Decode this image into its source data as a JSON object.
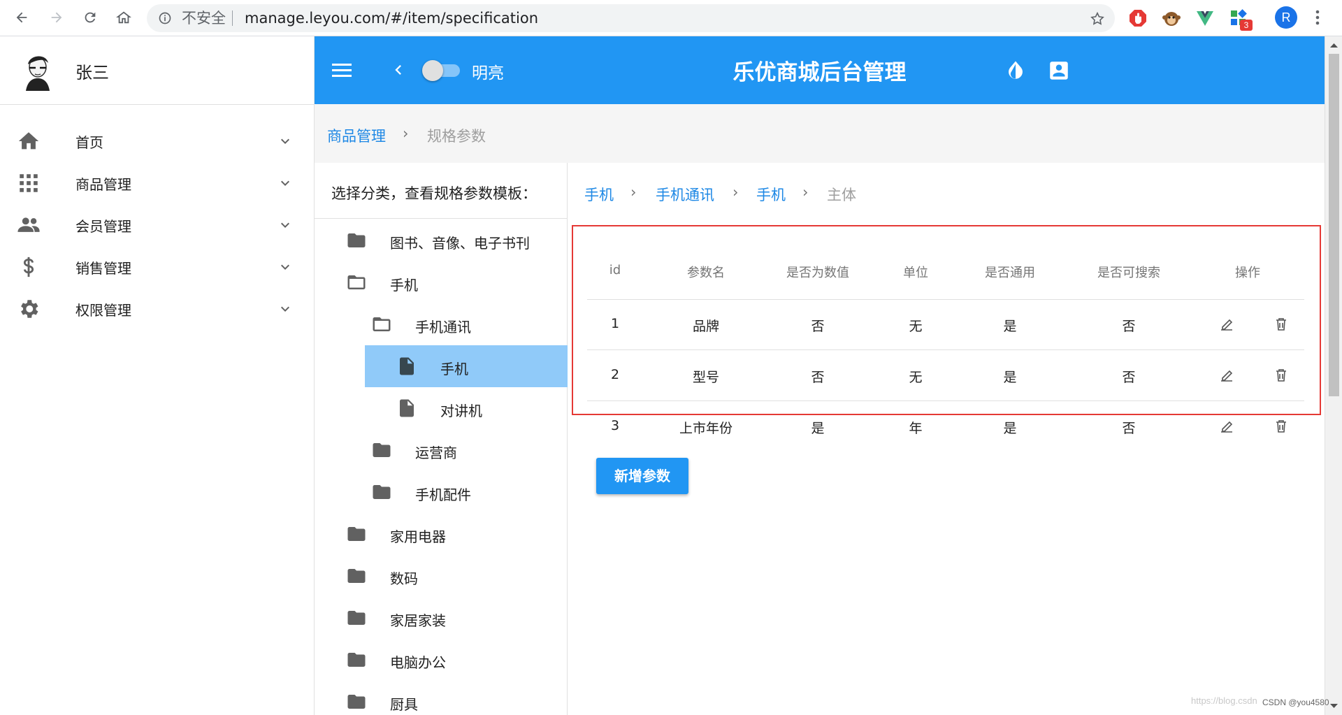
{
  "browser": {
    "insecure_label": "不安全",
    "url": "manage.leyou.com/#/item/specification",
    "extension_badge": "3",
    "profile_initial": "R"
  },
  "sidebar": {
    "user_name": "张三",
    "items": [
      {
        "label": "首页",
        "icon": "home-icon"
      },
      {
        "label": "商品管理",
        "icon": "apps-grid-icon"
      },
      {
        "label": "会员管理",
        "icon": "people-icon"
      },
      {
        "label": "销售管理",
        "icon": "dollar-icon"
      },
      {
        "label": "权限管理",
        "icon": "gear-icon"
      }
    ]
  },
  "toolbar": {
    "theme_toggle_label": "明亮",
    "title": "乐优商城后台管理"
  },
  "breadcrumb": {
    "parent": "商品管理",
    "current": "规格参数"
  },
  "tree": {
    "header": "选择分类，查看规格参数模板：",
    "nodes": [
      {
        "label": "图书、音像、电子书刊"
      },
      {
        "label": "手机"
      },
      {
        "label": "手机通讯"
      },
      {
        "label": "手机"
      },
      {
        "label": "对讲机"
      },
      {
        "label": "运营商"
      },
      {
        "label": "手机配件"
      },
      {
        "label": "家用电器"
      },
      {
        "label": "数码"
      },
      {
        "label": "家居家装"
      },
      {
        "label": "电脑办公"
      },
      {
        "label": "厨具"
      }
    ]
  },
  "main": {
    "path": [
      "手机",
      "手机通讯",
      "手机",
      "主体"
    ],
    "table": {
      "headers": [
        "id",
        "参数名",
        "是否为数值",
        "单位",
        "是否通用",
        "是否可搜索",
        "操作"
      ],
      "rows": [
        {
          "id": "1",
          "name": "品牌",
          "numeric": "否",
          "unit": "无",
          "generic": "是",
          "searching": "否"
        },
        {
          "id": "2",
          "name": "型号",
          "numeric": "否",
          "unit": "无",
          "generic": "是",
          "searching": "否"
        },
        {
          "id": "3",
          "name": "上市年份",
          "numeric": "是",
          "unit": "年",
          "generic": "是",
          "searching": "否"
        }
      ]
    },
    "add_button_label": "新增参数"
  },
  "watermark": "https://blog.csdn",
  "watermark_credit": "CSDN @you4580",
  "colors": {
    "primary": "#2196f3",
    "selected_row": "#90caf9",
    "link": "#1e88e5",
    "highlight_border": "#e53935"
  }
}
